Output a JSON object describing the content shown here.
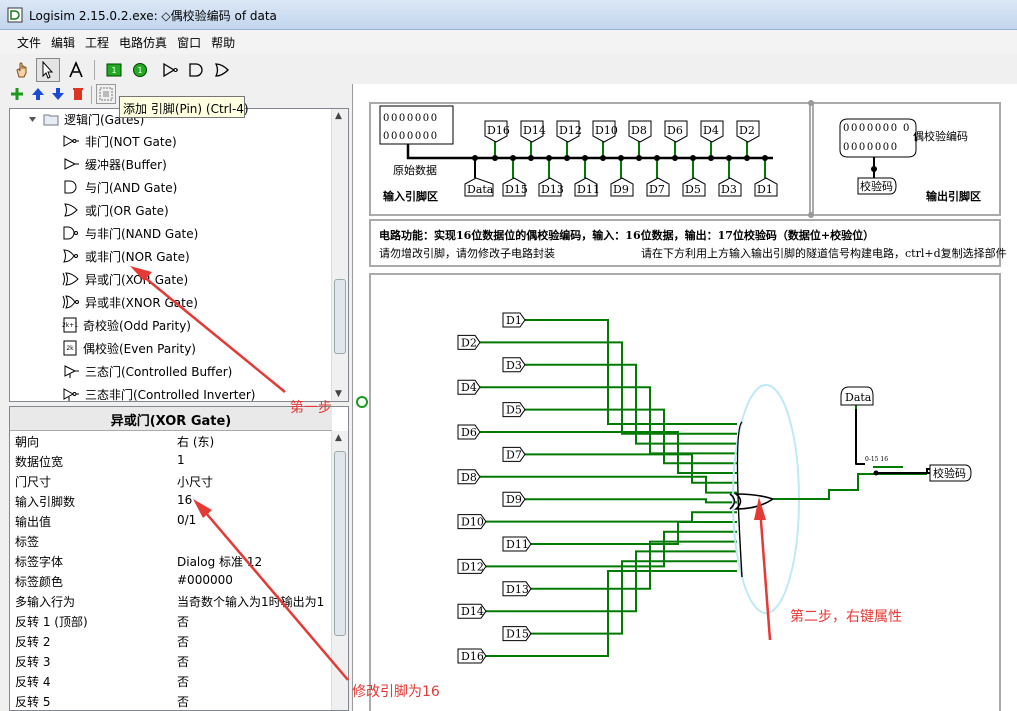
{
  "window": {
    "title": "Logisim 2.15.0.2.exe: ◇偶校验编码 of data"
  },
  "menu": [
    "文件",
    "编辑",
    "工程",
    "电路仿真",
    "窗口",
    "帮助"
  ],
  "tooltip": "添加 引脚(Pin) (Ctrl-4)",
  "tree": {
    "folder": "逻辑门(Gates)",
    "items": [
      {
        "label": "非门(NOT Gate)",
        "icon": "not-gate-icon"
      },
      {
        "label": "缓冲器(Buffer)",
        "icon": "buffer-icon"
      },
      {
        "label": "与门(AND Gate)",
        "icon": "and-gate-icon"
      },
      {
        "label": "或门(OR Gate)",
        "icon": "or-gate-icon"
      },
      {
        "label": "与非门(NAND Gate)",
        "icon": "nand-gate-icon"
      },
      {
        "label": "或非门(NOR Gate)",
        "icon": "nor-gate-icon"
      },
      {
        "label": "异或门(XOR Gate)",
        "icon": "xor-gate-icon"
      },
      {
        "label": "异或非(XNOR Gate)",
        "icon": "xnor-gate-icon"
      },
      {
        "label": "奇校验(Odd Parity)",
        "icon": "odd-parity-icon"
      },
      {
        "label": "偶校验(Even Parity)",
        "icon": "even-parity-icon"
      },
      {
        "label": "三态门(Controlled Buffer)",
        "icon": "controlled-buffer-icon"
      },
      {
        "label": "三态非门(Controlled Inverter)",
        "icon": "controlled-inverter-icon"
      }
    ]
  },
  "props": {
    "title": "异或门(XOR Gate)",
    "rows": [
      {
        "k": "朝向",
        "v": "右 (东)"
      },
      {
        "k": "数据位宽",
        "v": "1"
      },
      {
        "k": "门尺寸",
        "v": "小尺寸"
      },
      {
        "k": "输入引脚数",
        "v": "16"
      },
      {
        "k": "输出值",
        "v": "0/1"
      },
      {
        "k": "标签",
        "v": ""
      },
      {
        "k": "标签字体",
        "v": "Dialog 标准 12"
      },
      {
        "k": "标签颜色",
        "v": "#000000"
      },
      {
        "k": "多输入行为",
        "v": "当奇数个输入为1时输出为1"
      },
      {
        "k": "反转 1 (顶部)",
        "v": "否"
      },
      {
        "k": "反转 2",
        "v": "否"
      },
      {
        "k": "反转 3",
        "v": "否"
      },
      {
        "k": "反转 4",
        "v": "否"
      },
      {
        "k": "反转 5",
        "v": "否"
      }
    ]
  },
  "canvas": {
    "input_box": {
      "top_pins": [
        "D16",
        "D14",
        "D12",
        "D10",
        "D8",
        "D6",
        "D4",
        "D2"
      ],
      "bottom_pins": [
        "Data",
        "D15",
        "D13",
        "D11",
        "D9",
        "D7",
        "D5",
        "D3",
        "D1"
      ],
      "raw_label": "原始数据",
      "area_label": "输入引脚区",
      "bits": "0000000"
    },
    "output_box": {
      "bits_top": "0",
      "bits": "0000000",
      "title": "偶校验编码",
      "pin": "校验码",
      "area_label": "输出引脚区"
    },
    "description": {
      "line1": "电路功能：实现16位数据位的偶校验编码，输入：16位数据，输出：17位校验码（数据位+校验位）",
      "line2a": "请勿增改引脚，请勿修改子电路封装",
      "line2b": "请在下方利用上方输入输出引脚的隧道信号构建电路，ctrl+d复制选择部件"
    },
    "circuit": {
      "left_pins": [
        "D1",
        "D2",
        "D3",
        "D4",
        "D5",
        "D6",
        "D7",
        "D8",
        "D9",
        "D10",
        "D11",
        "D12",
        "D13",
        "D14",
        "D15",
        "D16"
      ],
      "data_pin": "Data",
      "output_pin": "校验码",
      "splitter_label": "0-15 16"
    }
  },
  "annotations": {
    "step1": "第一步",
    "step2": "第二步，右键属性",
    "modify": "修改引脚为16"
  },
  "colors": {
    "wire": "#007a00",
    "annotation": "#e53935",
    "tooltip": "#ffffe1"
  }
}
